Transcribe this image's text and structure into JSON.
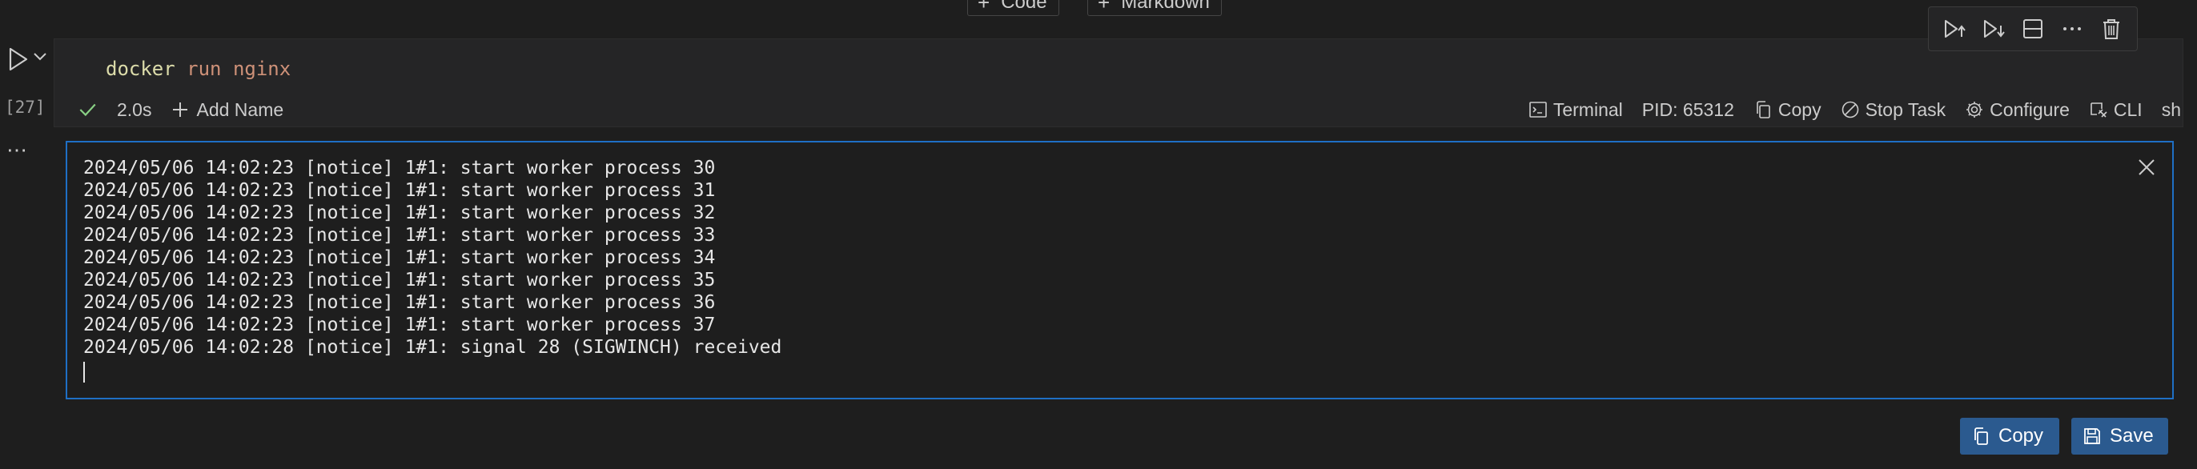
{
  "insert": {
    "code_label": "Code",
    "markdown_label": "Markdown"
  },
  "gutter": {
    "execution_count": "[27]",
    "more": "⋯"
  },
  "cell": {
    "code_command": "docker",
    "code_args": " run nginx"
  },
  "status": {
    "duration": "2.0s",
    "add_name": "Add Name",
    "terminal": "Terminal",
    "pid": "PID: 65312",
    "copy": "Copy",
    "stop_task": "Stop Task",
    "configure": "Configure",
    "cli": "CLI",
    "shell": "sh"
  },
  "output": {
    "lines": [
      "2024/05/06 14:02:23 [notice] 1#1: start worker process 30",
      "2024/05/06 14:02:23 [notice] 1#1: start worker process 31",
      "2024/05/06 14:02:23 [notice] 1#1: start worker process 32",
      "2024/05/06 14:02:23 [notice] 1#1: start worker process 33",
      "2024/05/06 14:02:23 [notice] 1#1: start worker process 34",
      "2024/05/06 14:02:23 [notice] 1#1: start worker process 35",
      "2024/05/06 14:02:23 [notice] 1#1: start worker process 36",
      "2024/05/06 14:02:23 [notice] 1#1: start worker process 37",
      "2024/05/06 14:02:28 [notice] 1#1: signal 28 (SIGWINCH) received"
    ]
  },
  "actions": {
    "copy_label": "Copy",
    "save_label": "Save"
  },
  "colors": {
    "accent": "#1f6fc5",
    "button": "#2b5a8f",
    "success": "#89d185"
  }
}
